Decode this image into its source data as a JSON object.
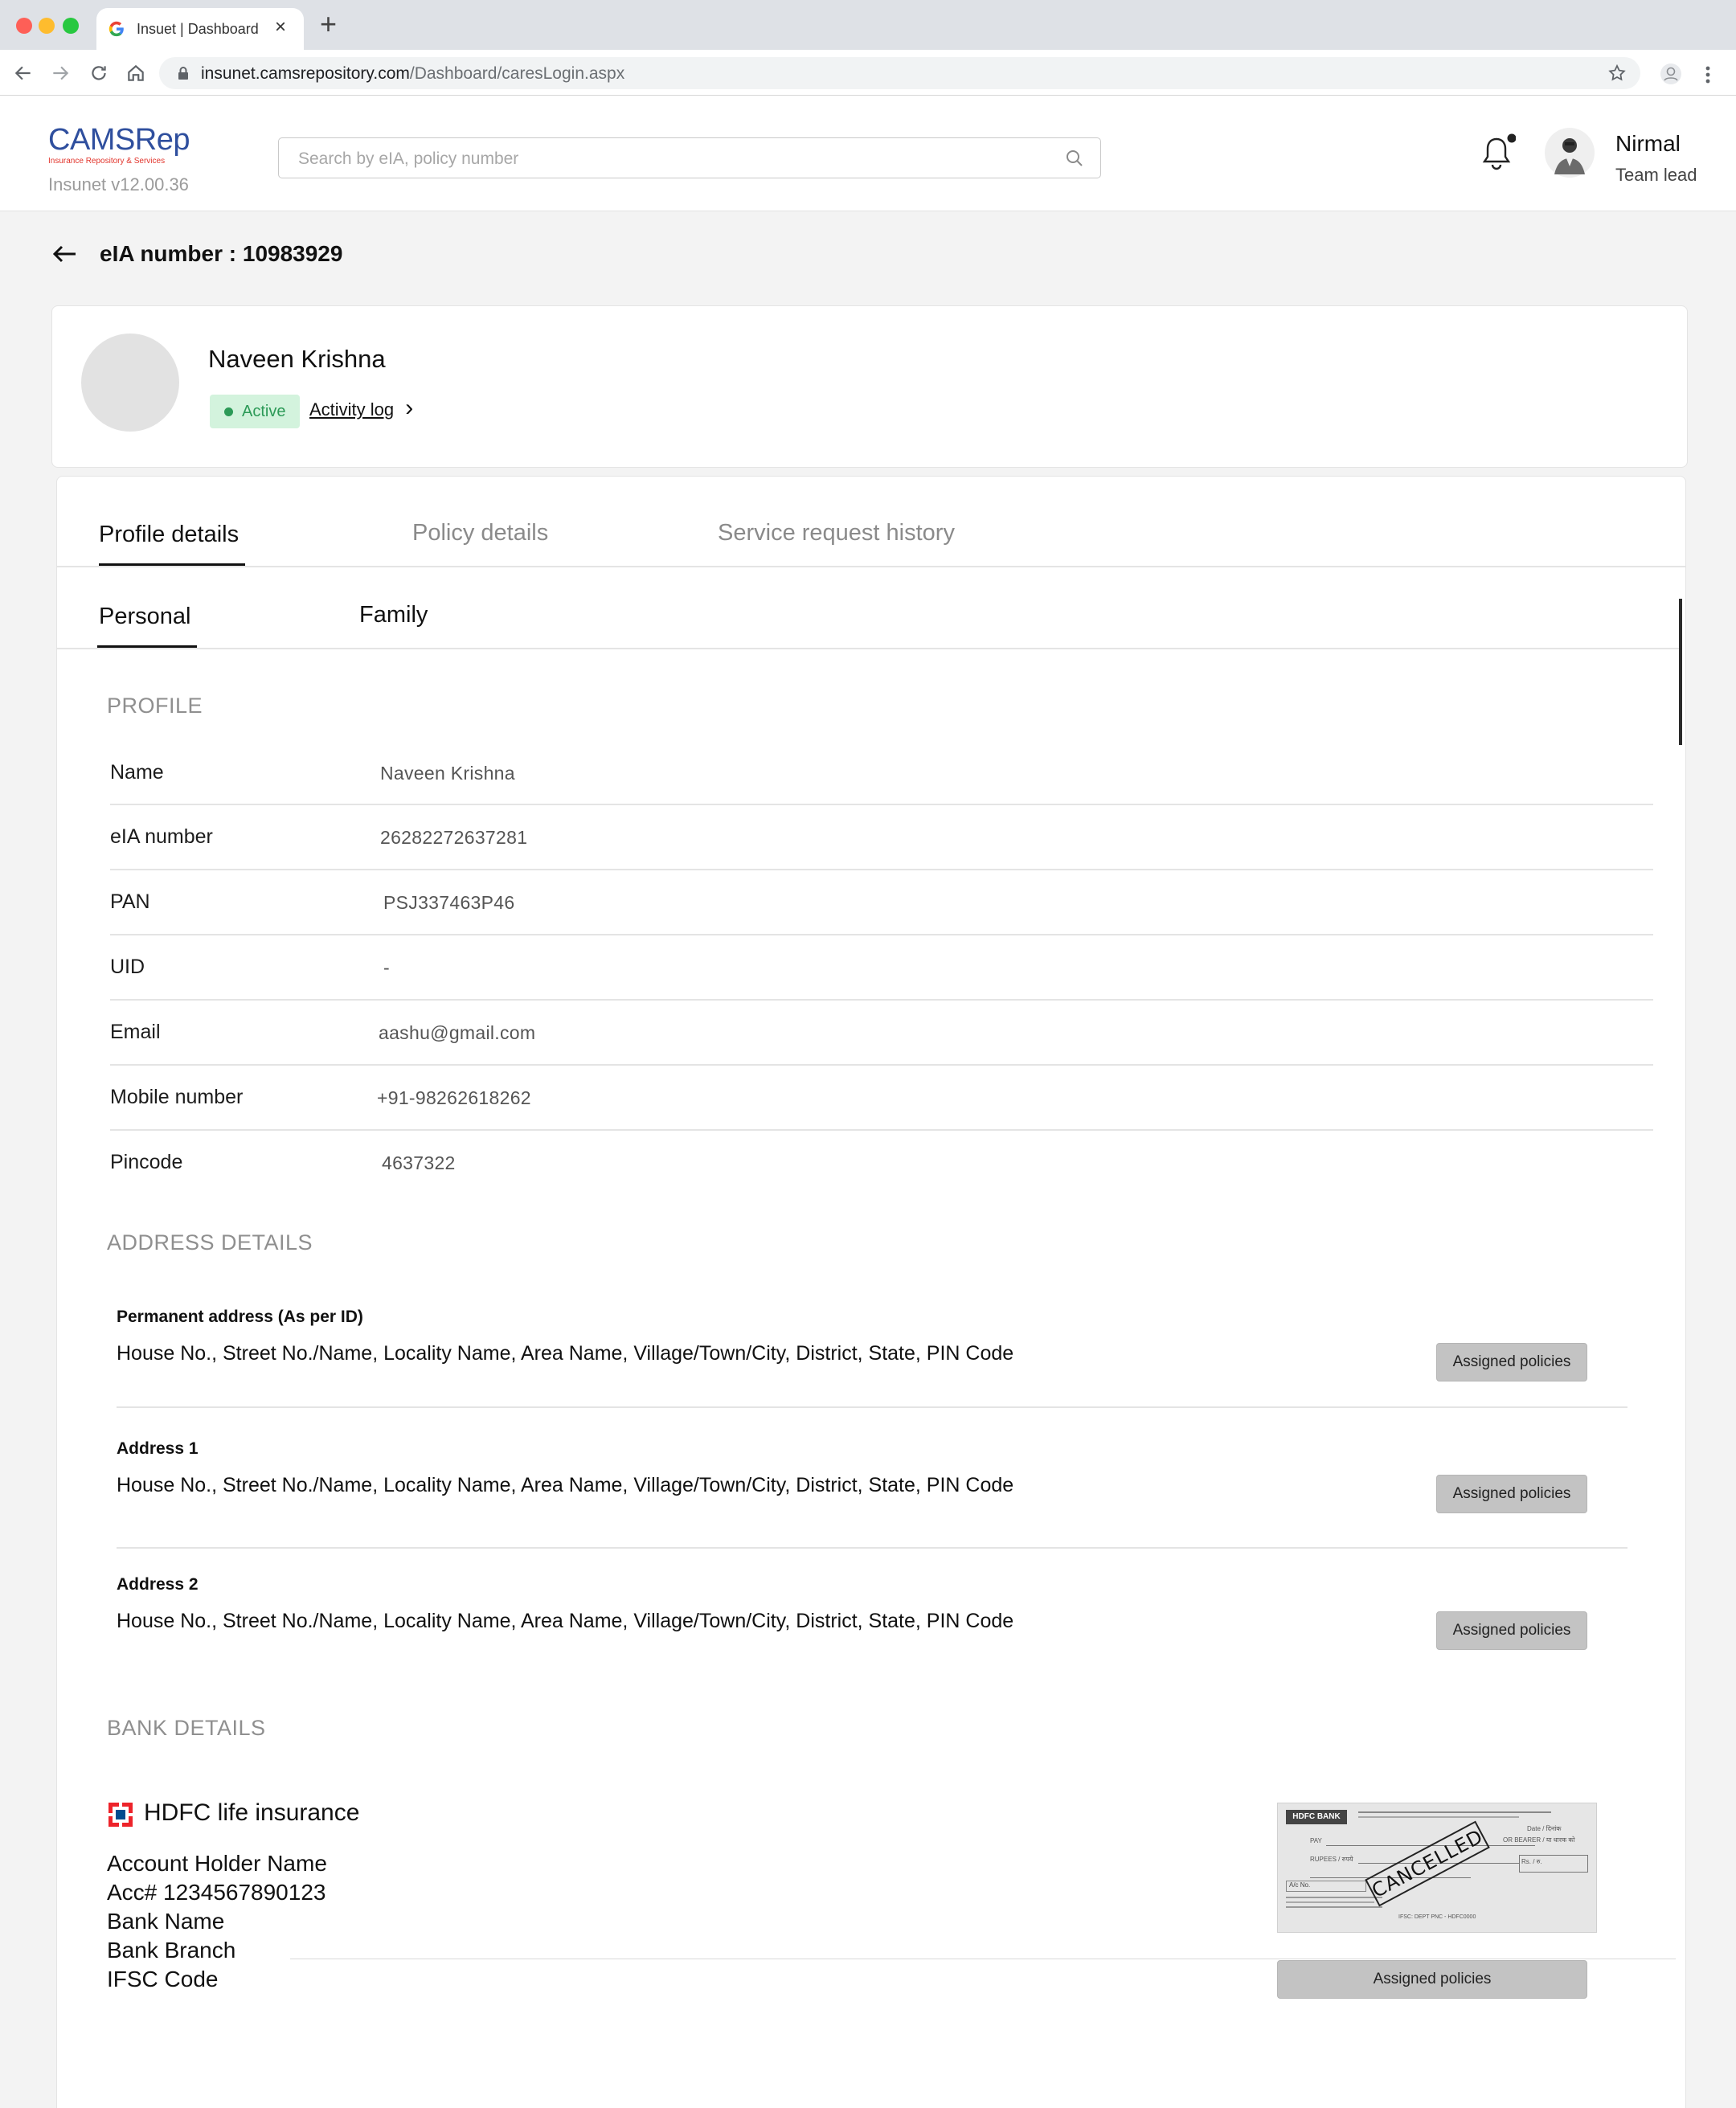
{
  "browser": {
    "tab_title": "Insuet | Dashboard",
    "new_tab_glyph": "+",
    "close_glyph": "×",
    "url_domain": "insunet.camsrepository.com",
    "url_path": "/Dashboard/caresLogin.aspx"
  },
  "header": {
    "logo_main": "CAMSRep",
    "logo_sub": "Insurance Repository & Services",
    "version": "Insunet v12.00.36",
    "search_placeholder": "Search by eIA, policy number",
    "user_name": "Nirmal",
    "user_role": "Team lead"
  },
  "page": {
    "back_glyph": "←",
    "title": "eIA number : 10983929"
  },
  "profile_card": {
    "name": "Naveen Krishna",
    "status": "Active",
    "activity_link": "Activity log",
    "activity_chevron": "›"
  },
  "tabs": [
    "Profile details",
    "Policy details",
    "Service request history"
  ],
  "subtabs": [
    "Personal",
    "Family"
  ],
  "profile_section": {
    "heading": "PROFILE",
    "rows": [
      {
        "label": "Name",
        "value": "Naveen Krishna"
      },
      {
        "label": "eIA number",
        "value": "26282272637281"
      },
      {
        "label": "PAN",
        "value": "PSJ337463P46"
      },
      {
        "label": "UID",
        "value": "-"
      },
      {
        "label": "Email",
        "value": "aashu@gmail.com"
      },
      {
        "label": "Mobile number",
        "value": "+91-98262618262"
      },
      {
        "label": "Pincode",
        "value": "4637322"
      }
    ]
  },
  "address_section": {
    "heading": "ADDRESS DETAILS",
    "addresses": [
      {
        "title": "Permanent address (As per ID)",
        "text": "House No., Street No./Name, Locality Name, Area Name, Village/Town/City, District, State, PIN Code",
        "button": "Assigned policies"
      },
      {
        "title": "Address 1",
        "text": "House No., Street No./Name, Locality Name, Area Name, Village/Town/City, District, State, PIN Code",
        "button": "Assigned policies"
      },
      {
        "title": "Address 2",
        "text": "House No., Street No./Name, Locality Name, Area Name, Village/Town/City, District, State, PIN Code",
        "button": "Assigned policies"
      }
    ]
  },
  "bank_section": {
    "heading": "BANK DETAILS",
    "bank_title": "HDFC life insurance",
    "lines": [
      "Account Holder Name",
      "Acc# 1234567890123",
      "Bank Name",
      "Bank Branch",
      "IFSC Code"
    ],
    "cheque": {
      "bank": "HDFC BANK",
      "stamp": "CANCELLED",
      "pay": "PAY",
      "rupees": "RUPEES / रुपये",
      "bearer": "OR BEARER / या धारक को",
      "date": "Date / दिनांक",
      "rs": "Rs. / रु.",
      "ac": "A/c No.",
      "ifsc": "IFSC: DEPT PNC - HDFC0000"
    },
    "button": "Assigned policies"
  },
  "colors": {
    "active_badge_bg": "#d3f3dd",
    "active_badge_text": "#2c9a57",
    "logo_blue": "#2f4f9e",
    "logo_red": "#e2342b"
  }
}
